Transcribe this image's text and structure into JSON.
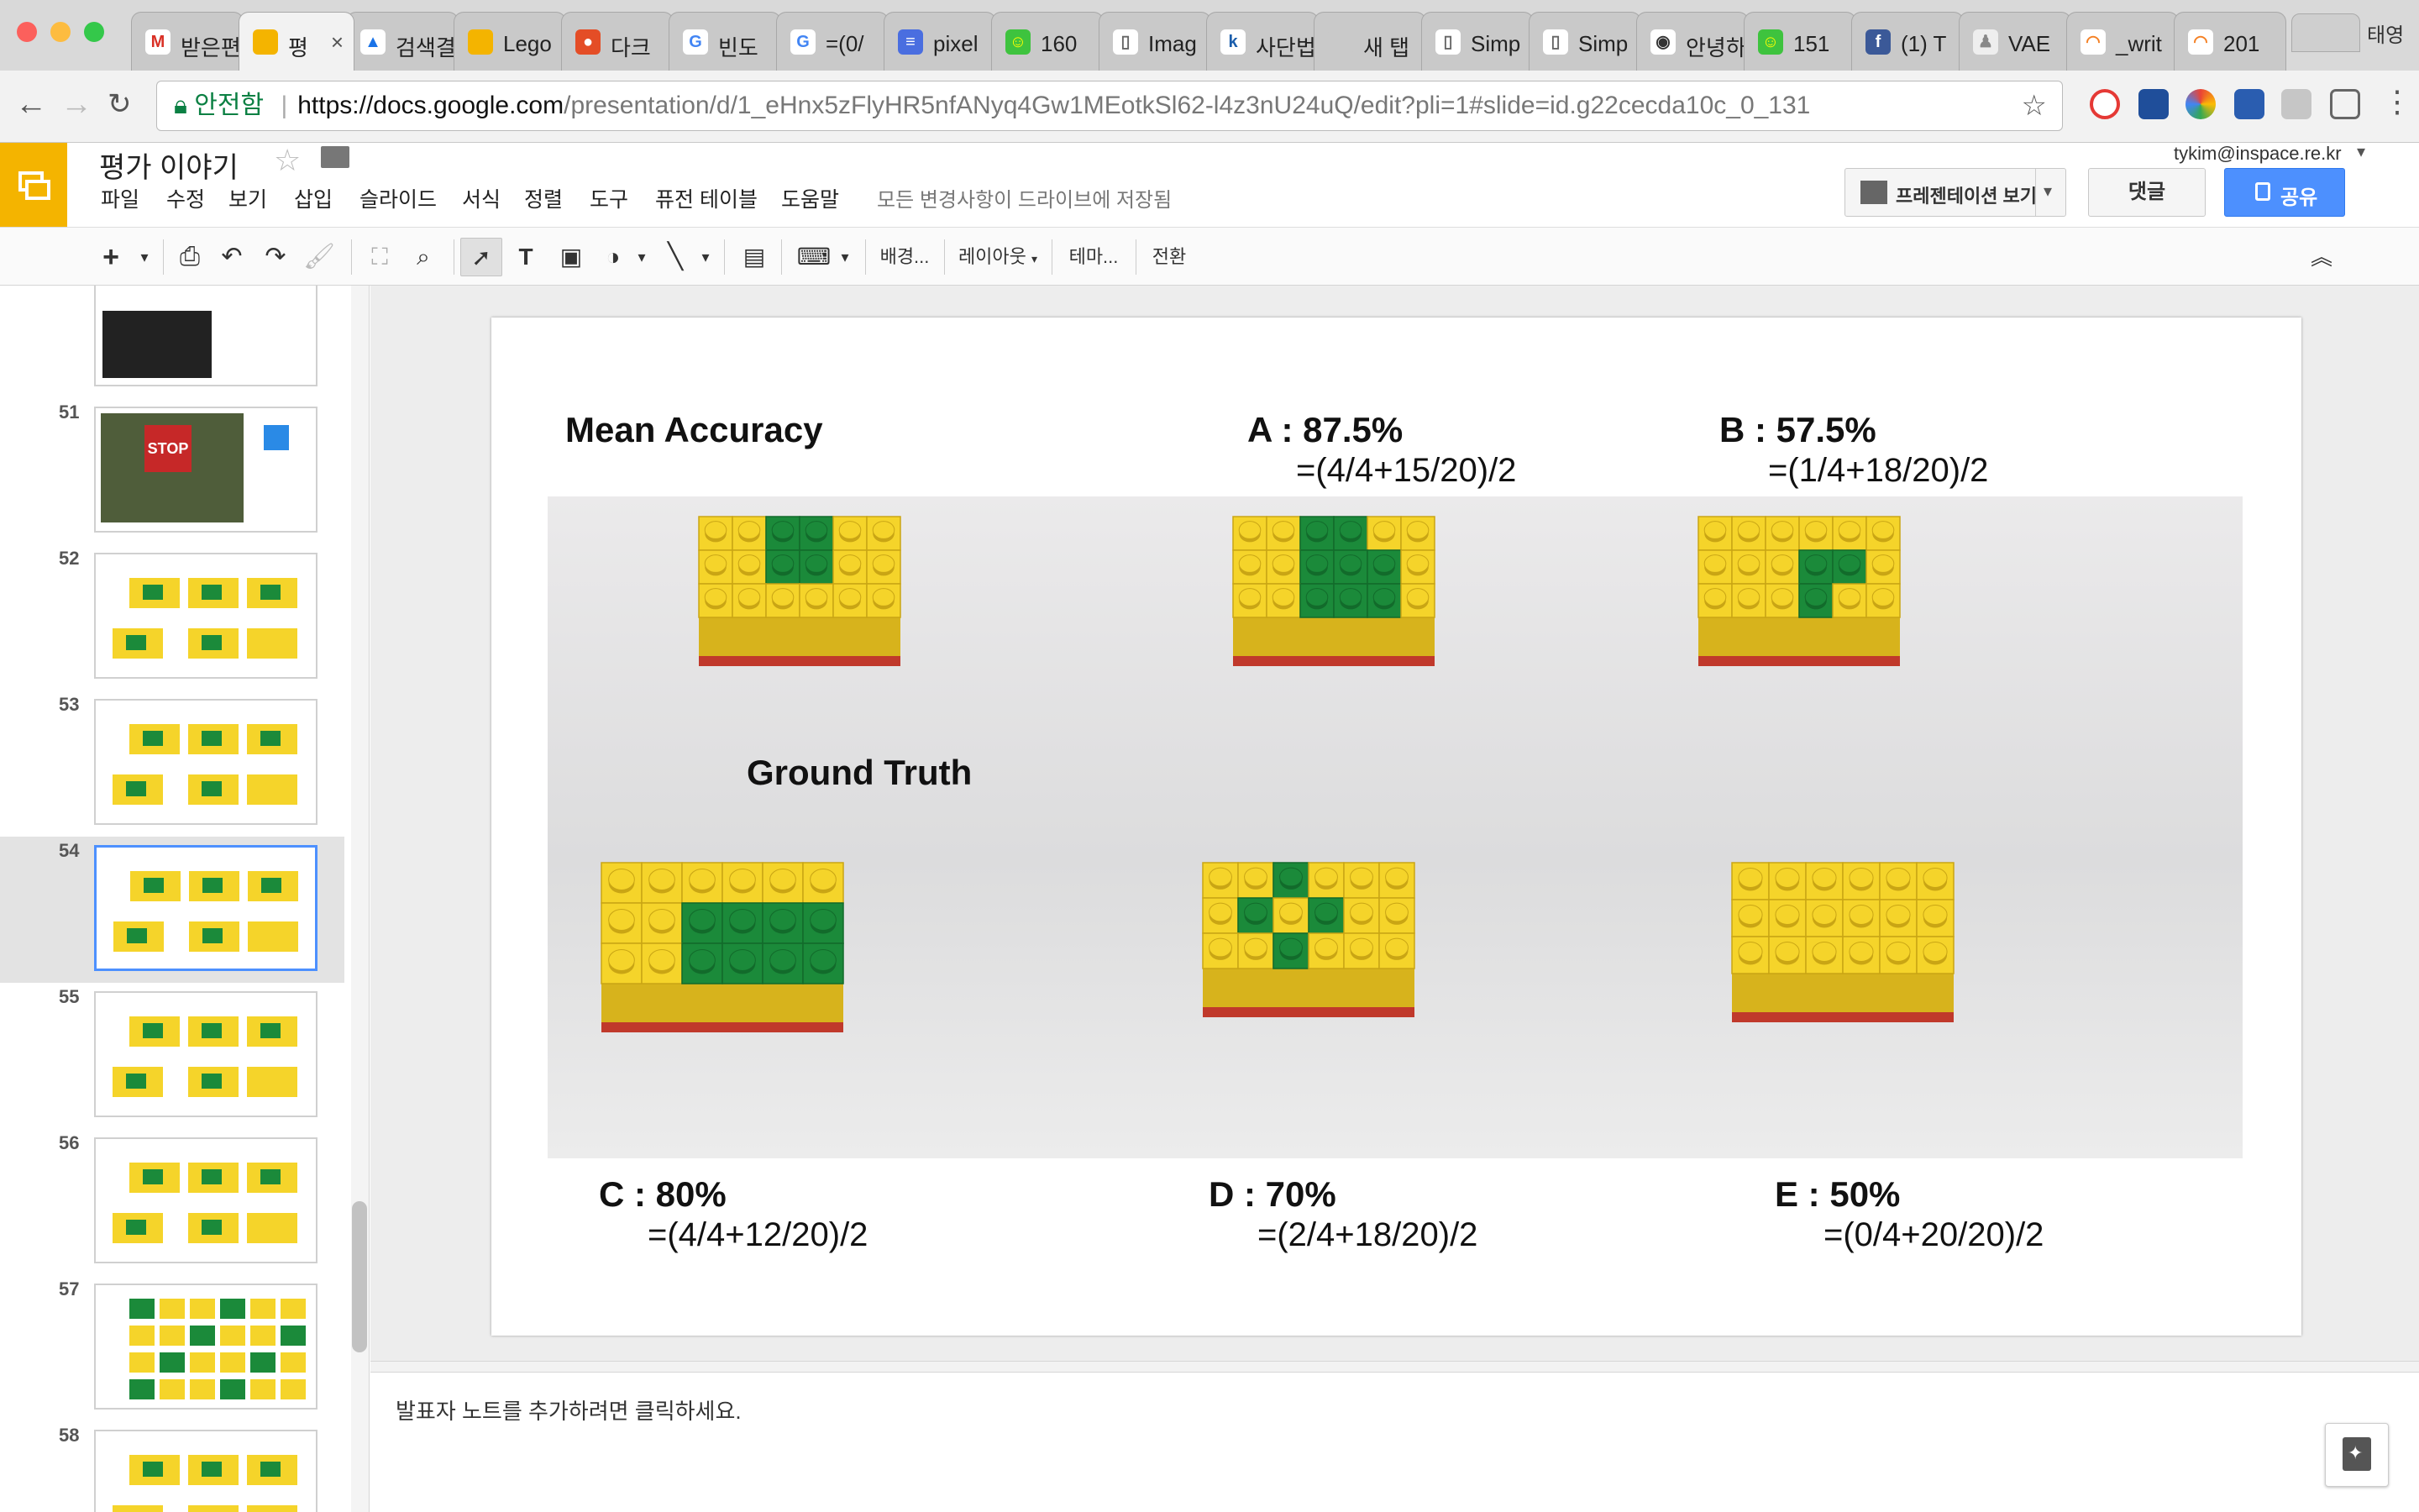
{
  "browser": {
    "profile_name": "태영",
    "tabs": [
      {
        "label": "받은편",
        "fav_glyph": "M",
        "fav_color": "#ffffff",
        "fav_text": "#d93025"
      },
      {
        "label": "평",
        "fav_glyph": "",
        "fav_color": "#f4b400",
        "fav_text": "#ffffff",
        "active": true
      },
      {
        "label": "검색결",
        "fav_glyph": "▲",
        "fav_color": "#ffffff",
        "fav_text": "#1a73e8"
      },
      {
        "label": "Lego",
        "fav_glyph": "",
        "fav_color": "#f4b400",
        "fav_text": "#ffffff"
      },
      {
        "label": "다크",
        "fav_glyph": "●",
        "fav_color": "#e44d26",
        "fav_text": "#ffffff"
      },
      {
        "label": "빈도",
        "fav_glyph": "G",
        "fav_color": "#ffffff",
        "fav_text": "#4285f4"
      },
      {
        "label": "=(0/",
        "fav_glyph": "G",
        "fav_color": "#ffffff",
        "fav_text": "#4285f4"
      },
      {
        "label": "pixel",
        "fav_glyph": "≡",
        "fav_color": "#4a6ee0",
        "fav_text": "#ffffff"
      },
      {
        "label": "160",
        "fav_glyph": "☺",
        "fav_color": "#3ec33e",
        "fav_text": "#ffff00"
      },
      {
        "label": "Imag",
        "fav_glyph": "▯",
        "fav_color": "#ffffff",
        "fav_text": "#666666"
      },
      {
        "label": "사단법",
        "fav_glyph": "k",
        "fav_color": "#ffffff",
        "fav_text": "#1a5dab"
      },
      {
        "label": "새 탭",
        "fav_glyph": "",
        "fav_color": "#c9c9c9",
        "fav_text": "#666666"
      },
      {
        "label": "Simp",
        "fav_glyph": "▯",
        "fav_color": "#ffffff",
        "fav_text": "#666666"
      },
      {
        "label": "Simp",
        "fav_glyph": "▯",
        "fav_color": "#ffffff",
        "fav_text": "#666666"
      },
      {
        "label": "안녕하",
        "fav_glyph": "◉",
        "fav_color": "#ffffff",
        "fav_text": "#333333"
      },
      {
        "label": "151",
        "fav_glyph": "☺",
        "fav_color": "#3ec33e",
        "fav_text": "#ffff00"
      },
      {
        "label": "(1) T",
        "fav_glyph": "f",
        "fav_color": "#3b5998",
        "fav_text": "#ffffff"
      },
      {
        "label": "VAE",
        "fav_glyph": "♟",
        "fav_color": "#eeeeee",
        "fav_text": "#888888"
      },
      {
        "label": "_writ",
        "fav_glyph": "◠",
        "fav_color": "#ffffff",
        "fav_text": "#f48024"
      },
      {
        "label": "201",
        "fav_glyph": "◠",
        "fav_color": "#ffffff",
        "fav_text": "#f48024"
      }
    ],
    "secure_label": "안전함",
    "url_host": "https://docs.google.com",
    "url_path": "/presentation/d/1_eHnx5zFlyHR5nfANyq4Gw1MEotkSl62-l4z3nU24uQ/edit?pli=1#slide=id.g22cecda10c_0_131"
  },
  "app": {
    "title": "평가 이야기",
    "user_email": "tykim@inspace.re.kr",
    "menu": [
      "파일",
      "수정",
      "보기",
      "삽입",
      "슬라이드",
      "서식",
      "정렬",
      "도구",
      "퓨전 테이블",
      "도움말"
    ],
    "save_status": "모든 변경사항이 드라이브에 저장됨",
    "present_label": "프레젠테이션 보기",
    "comments_label": "댓글",
    "share_label": "공유",
    "toolbar": {
      "background_label": "배경...",
      "layout_label": "레이아웃",
      "theme_label": "테마...",
      "transition_label": "전환"
    }
  },
  "filmstrip": {
    "slides": [
      {
        "number": "",
        "kind": "photo"
      },
      {
        "number": "51",
        "kind": "stop"
      },
      {
        "number": "52",
        "kind": "lego"
      },
      {
        "number": "53",
        "kind": "lego"
      },
      {
        "number": "54",
        "kind": "lego",
        "selected": true
      },
      {
        "number": "55",
        "kind": "lego"
      },
      {
        "number": "56",
        "kind": "lego"
      },
      {
        "number": "57",
        "kind": "grid"
      },
      {
        "number": "58",
        "kind": "lego"
      }
    ]
  },
  "slide": {
    "title": "Mean Accuracy",
    "a_label": "A : 87.5%",
    "a_formula": "=(4/4+15/20)/2",
    "b_label": "B : 57.5%",
    "b_formula": "=(1/4+18/20)/2",
    "ground_truth_label": "Ground Truth",
    "c_label": "C : 80%",
    "c_formula": "=(4/4+12/20)/2",
    "d_label": "D : 70%",
    "d_formula": "=(2/4+18/20)/2",
    "e_label": "E : 50%",
    "e_formula": "=(0/4+20/20)/2"
  },
  "notes": {
    "placeholder": "발표자 노트를 추가하려면 클릭하세요."
  },
  "colors": {
    "lego_yellow": "#f5d42a",
    "lego_green": "#1b8a3a",
    "lego_red": "#c0392b",
    "accent_blue": "#4d90fe",
    "docs_yellow": "#f4b400"
  }
}
